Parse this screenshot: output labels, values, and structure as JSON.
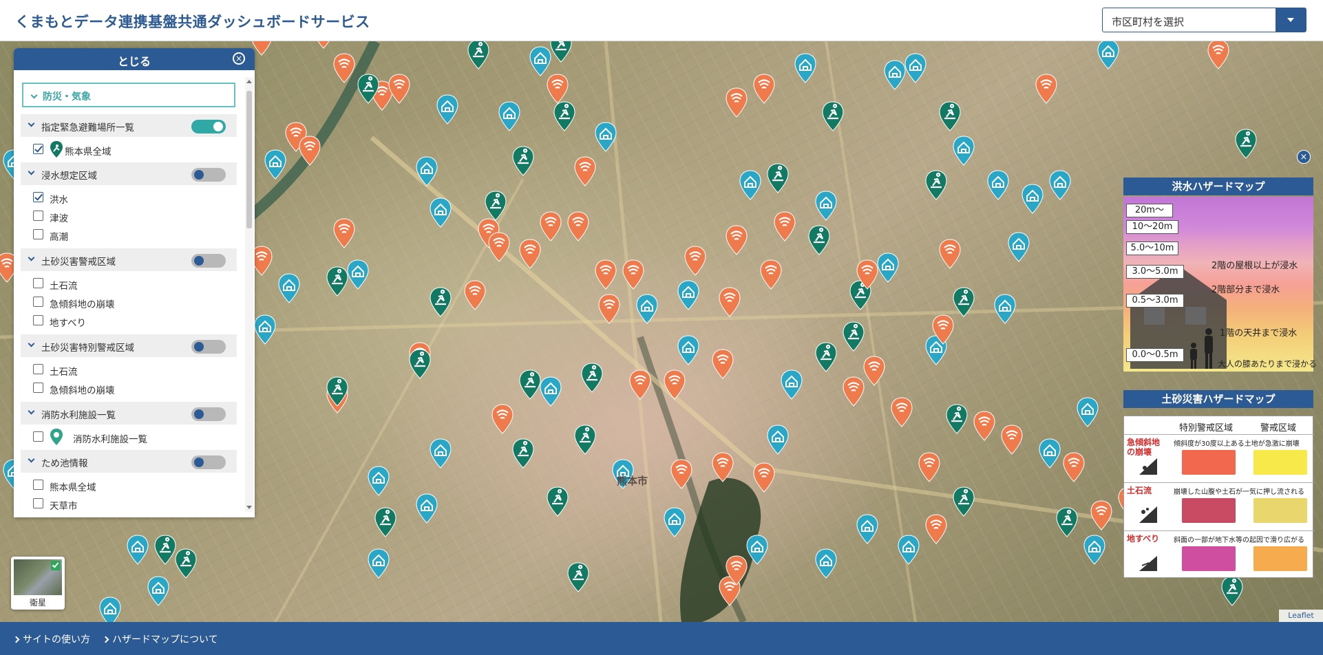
{
  "header": {
    "title": "くまもとデータ連携基盤共通ダッシュボードサービス",
    "city_select_placeholder": "市区町村を選択"
  },
  "panel": {
    "close_label": "とじる",
    "category": "防災・気象",
    "sections": [
      {
        "label": "指定緊急避難場所一覧",
        "toggle_on": true,
        "items": [
          {
            "label": "熊本県全域",
            "checked": true,
            "icon": "evacuation-pin-icon"
          }
        ]
      },
      {
        "label": "浸水想定区域",
        "toggle_on": false,
        "items": [
          {
            "label": "洪水",
            "checked": true
          },
          {
            "label": "津波",
            "checked": false
          },
          {
            "label": "高潮",
            "checked": false
          }
        ]
      },
      {
        "label": "土砂災害警戒区域",
        "toggle_on": false,
        "items": [
          {
            "label": "土石流",
            "checked": false
          },
          {
            "label": "急傾斜地の崩壊",
            "checked": false
          },
          {
            "label": "地すべり",
            "checked": false
          }
        ]
      },
      {
        "label": "土砂災害特別警戒区域",
        "toggle_on": false,
        "items": [
          {
            "label": "土石流",
            "checked": false
          },
          {
            "label": "急傾斜地の崩壊",
            "checked": false
          }
        ]
      },
      {
        "label": "消防水利施設一覧",
        "toggle_on": false,
        "items": [
          {
            "label": "消防水利施設一覧",
            "checked": false,
            "icon": "water-pin-icon"
          }
        ]
      },
      {
        "label": "ため池情報",
        "toggle_on": false,
        "items": [
          {
            "label": "熊本県全域",
            "checked": false
          },
          {
            "label": "天草市",
            "checked": false
          }
        ]
      }
    ]
  },
  "basemap": {
    "label": "衛星",
    "checked": true
  },
  "map": {
    "city_label": "熊本市",
    "marker_colors": {
      "evacuation": "#127a62",
      "shelter": "#2aa7c6",
      "wifi": "#ef7a4c"
    }
  },
  "flood_legend": {
    "title": "洪水ハザードマップ",
    "levels": [
      "20m〜",
      "10〜20m",
      "5.0〜10m",
      "3.0〜5.0m",
      "0.5〜3.0m",
      "0.0〜0.5m"
    ],
    "notes": [
      "2階の屋根以上が浸水",
      "2階部分まで浸水",
      "1階の天井まで浸水",
      "大人の膝あたりまで浸かる"
    ]
  },
  "sediment_legend": {
    "title": "土砂災害ハザードマップ",
    "col_special": "特別警戒区域",
    "col_warning": "警戒区域",
    "rows": [
      {
        "name": "急傾斜地の崩壊",
        "desc": "傾斜度が30度以上ある土地が急激に崩壊",
        "special_color": "#f2684e",
        "warning_color": "#f7e94a"
      },
      {
        "name": "土石流",
        "desc": "崩壊した山腹や土石が一気に押し流される",
        "special_color": "#c84b63",
        "warning_color": "#e9d66c"
      },
      {
        "name": "地すべり",
        "desc": "斜面の一部が地下水等の起因で滑り広がる",
        "special_color": "#cf4ea0",
        "warning_color": "#f5ab4e"
      }
    ]
  },
  "footer": {
    "link1": "サイトの使い方",
    "link2": "ハザードマップについて"
  },
  "attribution": "Leaflet"
}
